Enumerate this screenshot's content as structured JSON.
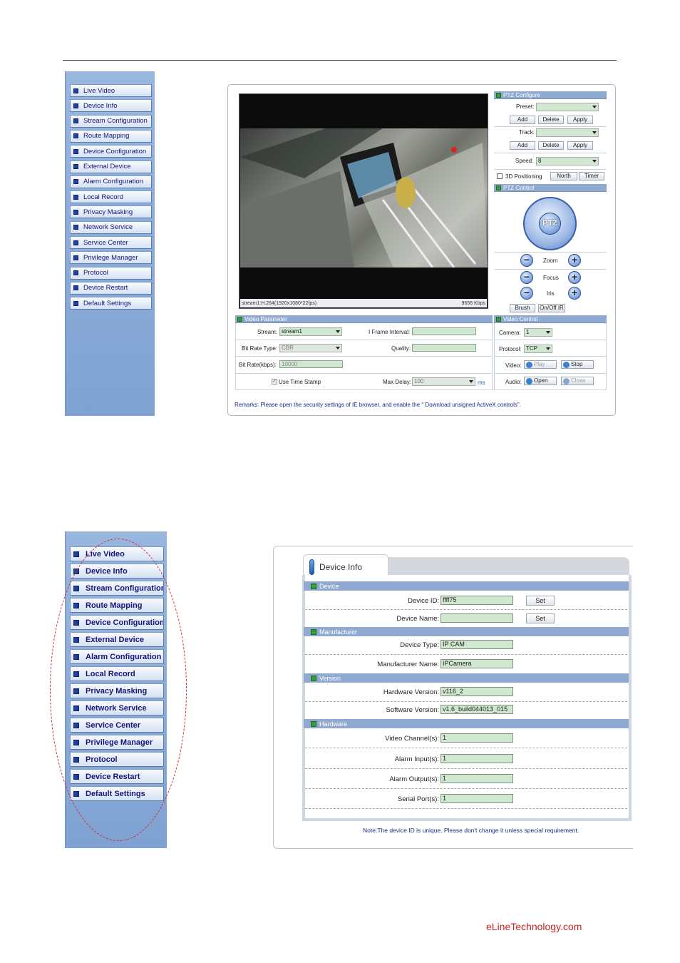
{
  "sidebar1": {
    "items": [
      "Live Video",
      "Device Info",
      "Stream Configuration",
      "Route Mapping",
      "Device Configuration",
      "External Device",
      "Alarm Configuration",
      "Local Record",
      "Privacy Masking",
      "Network Service",
      "Service Center",
      "Privilege Manager",
      "Protocol",
      "Device Restart",
      "Default Settings"
    ]
  },
  "sidebar2": {
    "items": [
      "Live Video",
      "Device Info",
      "Stream Configuration",
      "Route Mapping",
      "Device Configuration",
      "External Device",
      "Alarm Configuration",
      "Local Record",
      "Privacy Masking",
      "Network Service",
      "Service Center",
      "Privilege Manager",
      "Protocol",
      "Device Restart",
      "Default Settings"
    ]
  },
  "live": {
    "video_status_left": "stream1:H.264(1920x1080*22fps)",
    "video_status_right": "9656 Kbps",
    "ptz_configure": {
      "title": "PTZ Configure",
      "preset_label": "Preset:",
      "track_label": "Track:",
      "add": "Add",
      "delete": "Delete",
      "apply": "Apply",
      "speed_label": "Speed:",
      "speed_value": "8",
      "positioning_label": "3D Positioning",
      "north": "North",
      "timer": "Timer"
    },
    "ptz_control": {
      "title": "PTZ Control",
      "center": "PTZ",
      "zoom": "Zoom",
      "focus": "Focus",
      "iris": "Iris",
      "minus": "−",
      "plus": "+",
      "brush": "Brush",
      "onoff": "On/Off IR"
    },
    "video_parameter": {
      "title": "Video Parameter",
      "stream_label": "Stream:",
      "stream_value": "stream1",
      "iframe_label": "I Frame Interval:",
      "bitrate_type_label": "Bit Rate Type:",
      "bitrate_type_value": "CBR",
      "quality_label": "Quality:",
      "bitrate_label": "Bit Rate(kbps):",
      "bitrate_value": "10000",
      "timestamp_label": "Use Time Stamp",
      "maxdelay_label": "Max Delay:",
      "maxdelay_value": "100",
      "ms": "ms"
    },
    "video_control": {
      "title": "Video Control",
      "camera_label": "Camera:",
      "camera_value": "1",
      "protocol_label": "Protocol:",
      "protocol_value": "TCP",
      "video_label": "Video:",
      "play": "Play",
      "stop": "Stop",
      "audio_label": "Audio:",
      "open": "Open",
      "close": "Close"
    },
    "remarks": "Remarks: Please open the security settings of IE browser, and enable the \" Download unsigned ActiveX controls\"."
  },
  "device_info": {
    "tab": "Device Info",
    "sections": {
      "device": "Device",
      "manufacturer": "Manufacturer",
      "version": "Version",
      "hardware": "Hardware"
    },
    "device_id_label": "Device ID:",
    "device_id": "ffff75",
    "set": "Set",
    "device_name_label": "Device Name:",
    "device_name": "",
    "device_type_label": "Device Type:",
    "device_type": "IP CAM",
    "manufacturer_name_label": "Manufacturer Name:",
    "manufacturer_name": "IPCamera",
    "hardware_version_label": "Hardware Version:",
    "hardware_version": "v116_2",
    "software_version_label": "Software Version:",
    "software_version": "v1.6_build044013_015",
    "video_channels_label": "Video Channel(s):",
    "video_channels": "1",
    "alarm_inputs_label": "Alarm Input(s):",
    "alarm_inputs": "1",
    "alarm_outputs_label": "Alarm Output(s):",
    "alarm_outputs": "1",
    "serial_ports_label": "Serial Port(s):",
    "serial_ports": "1",
    "note": "Note:The device ID is unique. Please don't change it unless special requirement."
  },
  "footer": "eLineTechnology.com",
  "colors": {
    "header_blue": "#8fa9d1",
    "sidebar_blue": "#8aaad6",
    "field_green": "#cfe8cf",
    "highlight_red": "#d62a2a"
  }
}
